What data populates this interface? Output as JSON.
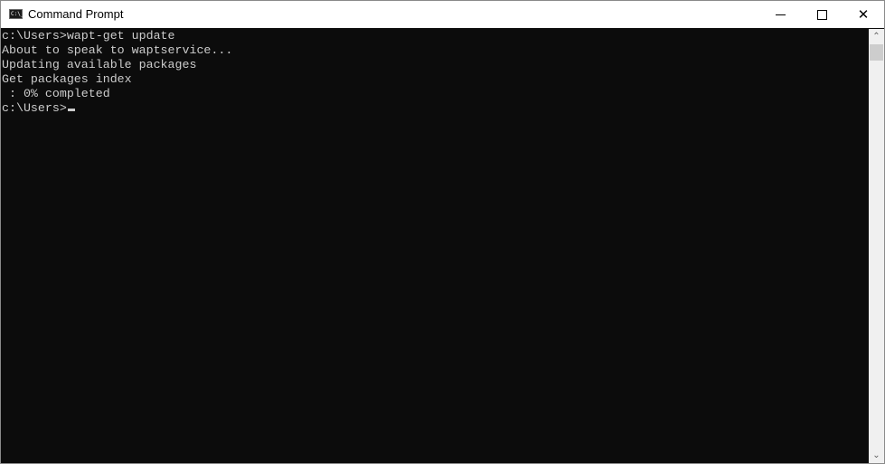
{
  "window": {
    "title": "Command Prompt",
    "icon": "cmd-icon",
    "icon_text": "C:\\_",
    "controls": {
      "minimize": "minimize-icon",
      "maximize": "maximize-icon",
      "close_glyph": "✕"
    }
  },
  "terminal": {
    "lines": [
      "c:\\Users>wapt-get update",
      "About to speak to waptservice...",
      "Updating available packages",
      "Get packages index",
      " : 0% completed"
    ],
    "prompt": "c:\\Users>",
    "progress_percent": 0
  },
  "scrollbar": {
    "up_glyph": "⌃",
    "down_glyph": "⌄"
  }
}
